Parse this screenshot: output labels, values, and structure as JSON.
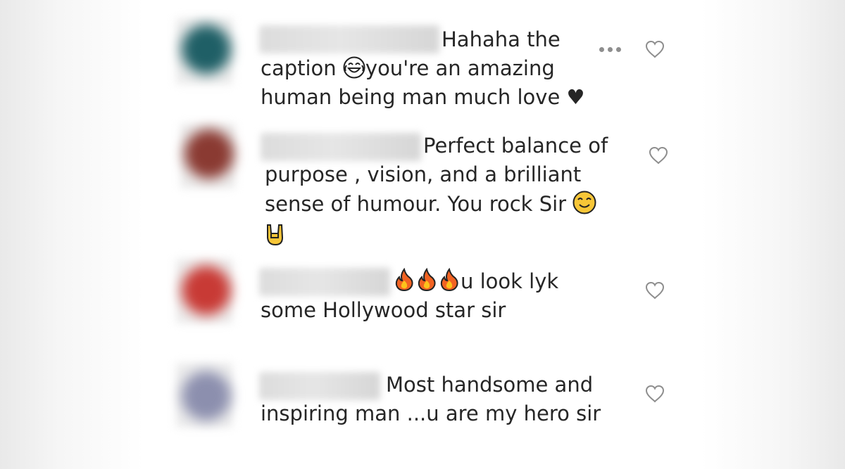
{
  "comments": [
    {
      "avatar_color": "#1f5f66",
      "lines": [
        "Hahaha the",
        "caption ",
        "you're an amazing",
        "human being man much love ♥"
      ],
      "emoji": "face-with-tears-of-joy-icon"
    },
    {
      "avatar_color": "#8a3a32",
      "lines": [
        "Perfect balance of",
        "purpose , vision, and a brilliant",
        "sense of humour. You rock Sir "
      ],
      "emoji": [
        "smiling-face-icon",
        "sign-of-the-horns-icon"
      ]
    },
    {
      "avatar_color": "#c83a35",
      "lines": [
        "u look lyk",
        "some Hollywood star sir"
      ],
      "emoji": "fire-icon"
    },
    {
      "avatar_color": "#8c8fae",
      "lines": [
        "Most handsome and",
        "inspiring man ...u are my hero sir"
      ]
    }
  ],
  "actions": {
    "more_label": "more-options-icon",
    "like_label": "heart-icon"
  },
  "colors": {
    "text": "#262626",
    "icon": "#8e8e8e"
  }
}
